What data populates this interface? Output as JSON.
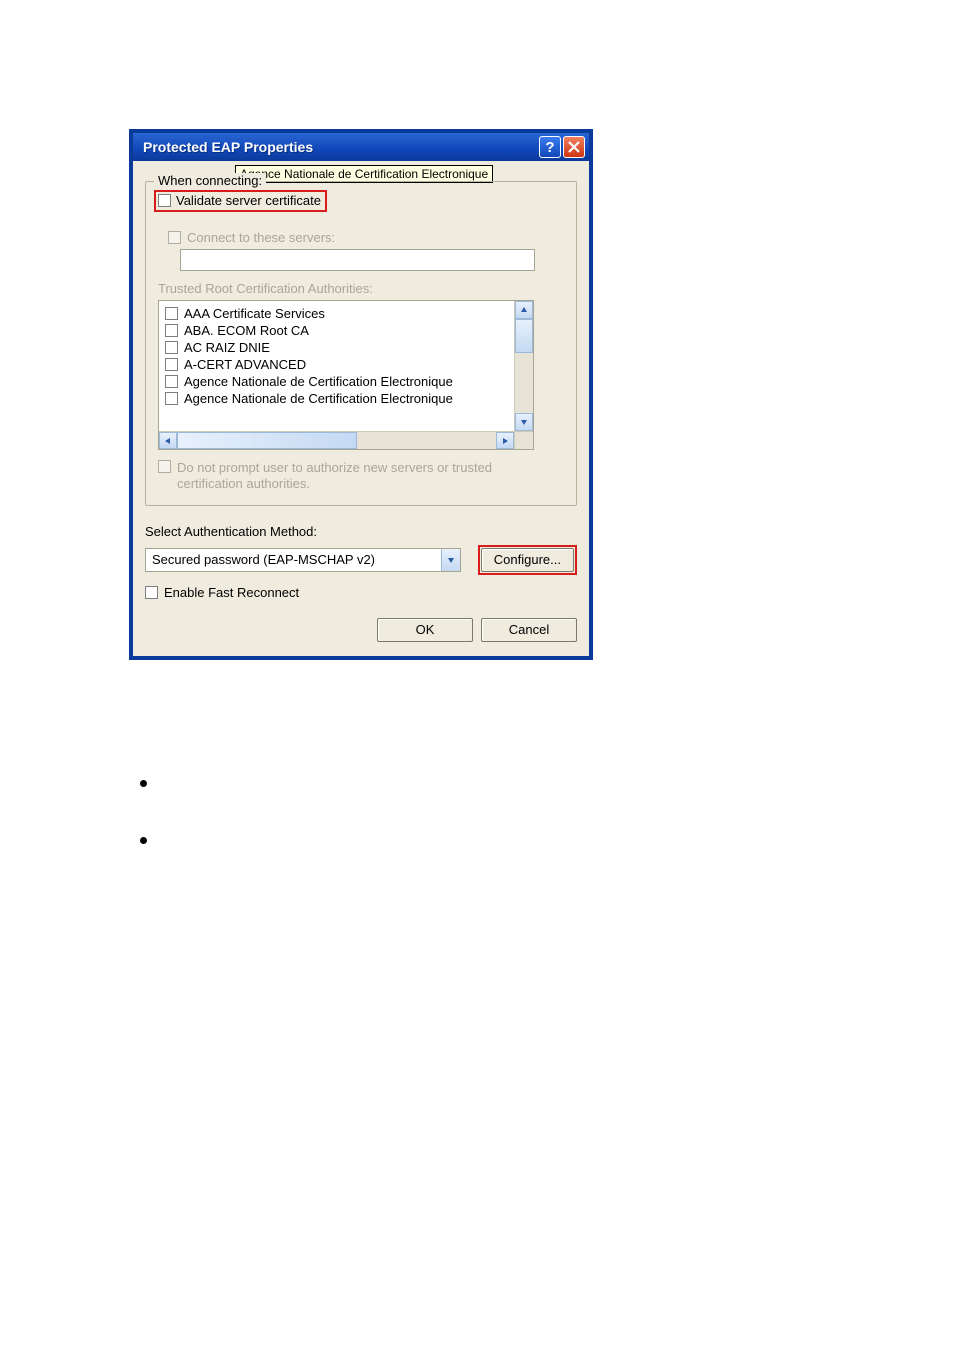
{
  "titlebar": {
    "title": "Protected EAP Properties"
  },
  "group": {
    "legend_prefix": "When connecting:",
    "tooltip": "Agence Nationale de Certification Electronique",
    "validate_label": "Validate server certificate",
    "connect_label": "Connect to these servers:",
    "trusted_label": "Trusted Root Certification Authorities:",
    "ca_items": [
      "AAA Certificate Services",
      "ABA. ECOM Root CA",
      "AC RAIZ DNIE",
      "A-CERT ADVANCED",
      "Agence Nationale de Certification Electronique",
      "Agence Nationale de Certification Electronique"
    ],
    "no_prompt_label": "Do not prompt user to authorize new servers or trusted certification authorities."
  },
  "auth": {
    "label": "Select Authentication Method:",
    "selected": "Secured password (EAP-MSCHAP v2)",
    "configure_label": "Configure..."
  },
  "fast_reconnect_label": "Enable Fast Reconnect",
  "buttons": {
    "ok": "OK",
    "cancel": "Cancel"
  }
}
